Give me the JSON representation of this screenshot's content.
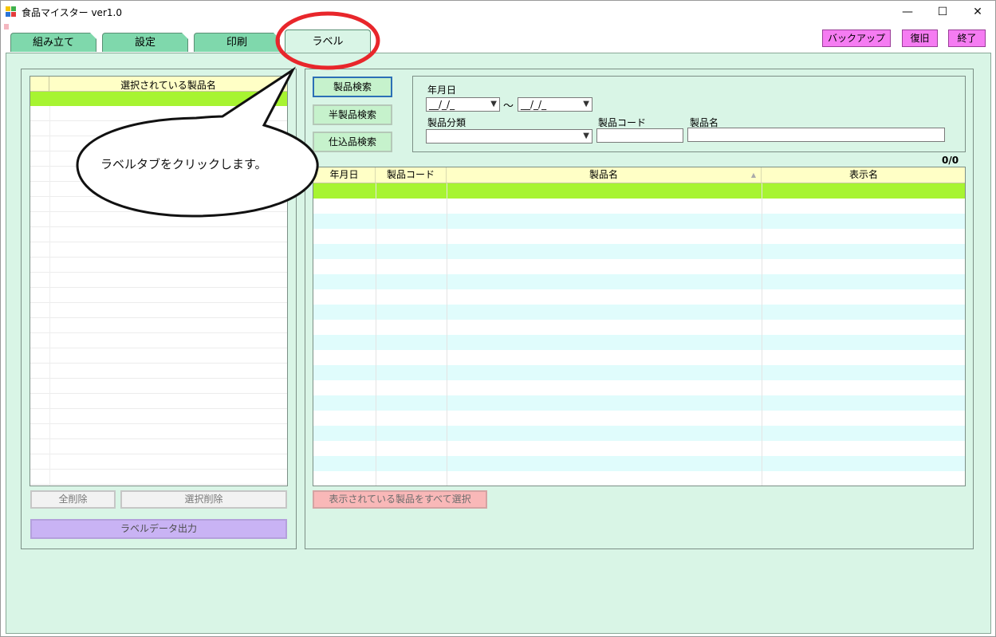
{
  "window": {
    "title": "食品マイスター ver1.0",
    "minimize": "—",
    "maximize": "☐",
    "close": "✕"
  },
  "tabs": [
    {
      "label": "組み立て"
    },
    {
      "label": "設定"
    },
    {
      "label": "印刷"
    },
    {
      "label": "ラベル"
    }
  ],
  "top_buttons": {
    "backup": "バックアップ",
    "restore": "復旧",
    "quit": "終了"
  },
  "left_panel": {
    "list_header": "選択されている製品名",
    "delete_all": "全削除",
    "delete_selected": "選択削除",
    "label_output": "ラベルデータ出力"
  },
  "search_buttons": {
    "product": "製品検索",
    "semi_product": "半製品検索",
    "prep_product": "仕込品検索"
  },
  "filters": {
    "date_label": "年月日",
    "date_from": "__/_/_",
    "date_to": "__/_/_",
    "range_sep": "～",
    "category_label": "製品分類",
    "category_value": "",
    "code_label": "製品コード",
    "code_value": "",
    "name_label": "製品名",
    "name_value": ""
  },
  "result_count": "0/0",
  "grid": {
    "columns": [
      "年月日",
      "製品コード",
      "製品名",
      "表示名"
    ]
  },
  "select_all_button": "表示されている製品をすべて選択",
  "annotation": {
    "callout": "ラベルタブをクリックします。"
  },
  "colors": {
    "panel_bg": "#d9f5e6",
    "tab_bg": "#7fd8ac",
    "header_yellow": "#ffffc6",
    "selected_green": "#a7f431",
    "row_cyan": "#e0fcfc",
    "top_button_magenta": "#f57cf2",
    "highlight_red": "#e8262b"
  }
}
